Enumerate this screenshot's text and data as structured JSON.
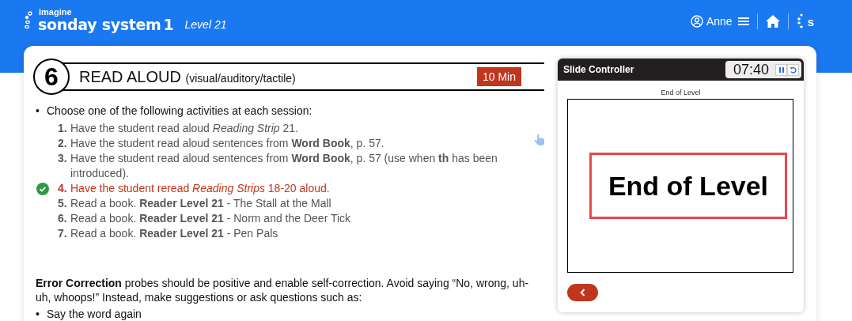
{
  "header": {
    "brand_small": "imagine",
    "brand": "sonday system",
    "brand_number": "1",
    "level": "Level 21",
    "user": "Anne",
    "logo_letter": "s"
  },
  "section": {
    "number": "6",
    "title": "READ ALOUD",
    "subtitle": "(visual/auditory/tactile)",
    "duration": "10 Min",
    "intro": {
      "bullet": "•",
      "text": "Choose one of the following activities at each session:"
    },
    "activities": [
      {
        "number": "1.",
        "text": "Have the student read aloud *Reading Strip* 21.",
        "checked": false
      },
      {
        "number": "2.",
        "text": "Have the student read aloud sentences from **Word Book**, p. 57.",
        "checked": false
      },
      {
        "number": "3.",
        "text": "Have the student read aloud sentences from **Word Book**, p. 57 (use when **th** has been introduced).",
        "checked": false
      },
      {
        "number": "4.",
        "text": "Have the student reread *Reading Strips* 18-20 aloud.",
        "checked": true
      },
      {
        "number": "5.",
        "text": "Read a book. **Reader Level 21** - The Stall at the Mall",
        "checked": false
      },
      {
        "number": "6.",
        "text": "Read a book. **Reader Level 21** - Norm and the Deer Tick",
        "checked": false
      },
      {
        "number": "7.",
        "text": "Read a book. **Reader Level 21** - Pen Pals",
        "checked": false
      }
    ],
    "error_correction": "**Error Correction** probes should be positive and enable self-correction. Avoid saying “No, wrong, uh-uh, whoops!” Instead, make suggestions or ask questions such as:",
    "suggestions": [
      {
        "bullet": "•",
        "text": "Say the word again"
      }
    ]
  },
  "slide_controller": {
    "title": "Slide Controller",
    "timer": "07:40",
    "caption": "End of Level",
    "slide_text": "End of Level"
  }
}
